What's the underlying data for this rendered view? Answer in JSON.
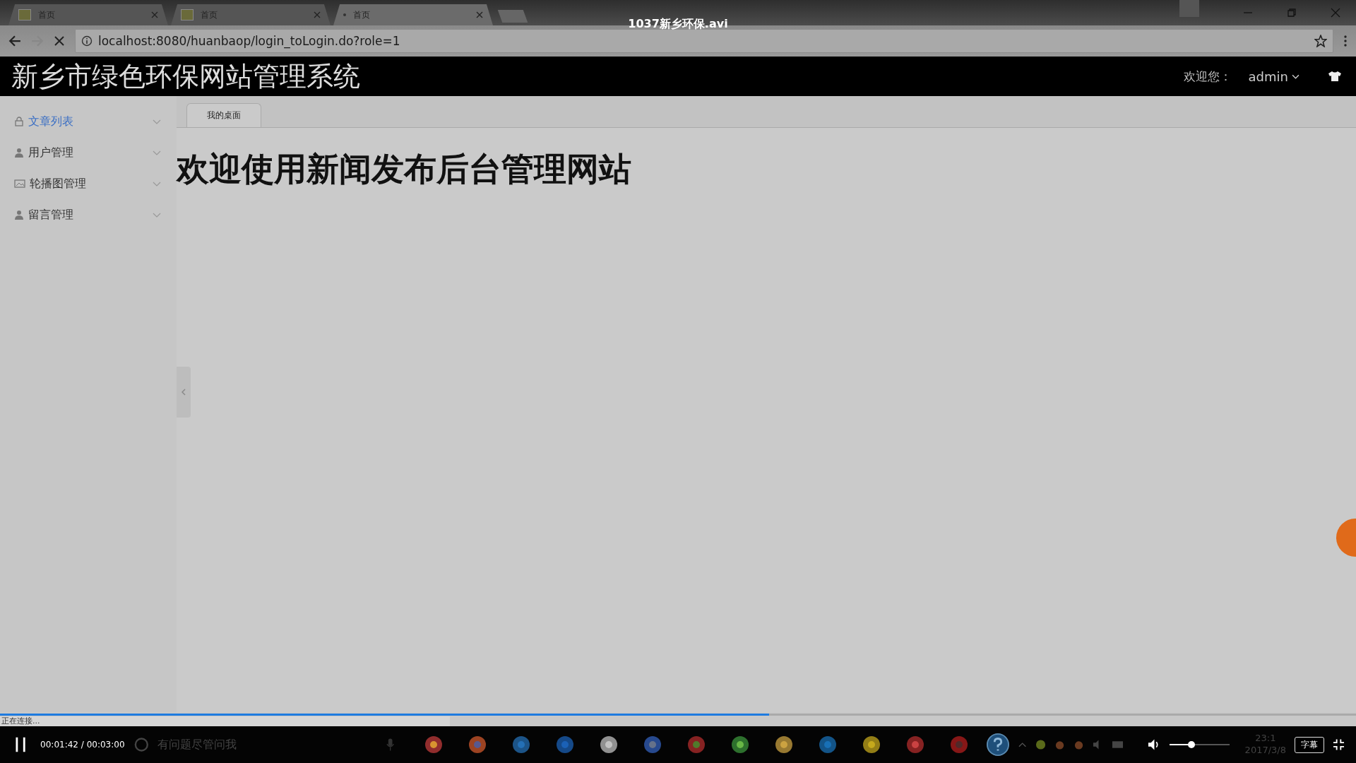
{
  "player": {
    "title": "1037新乡环保.avi",
    "playing": true,
    "time": "00:01:42 / 00:03:00",
    "progress": {
      "level": 0.567
    },
    "volume": {
      "level": 0.37
    },
    "subtitle_button": "字幕"
  },
  "browser": {
    "tabs": [
      {
        "label": "首页",
        "selected": false
      },
      {
        "label": "首页",
        "selected": false
      },
      {
        "label": "首页",
        "selected": true
      }
    ],
    "loading": true,
    "address": "localhost:8080/huanbaop/login_toLogin.do?role=1",
    "status": "正在连接..."
  },
  "app": {
    "title": "新乡市绿色环保网站管理系统",
    "welcome": "欢迎您：",
    "user": "admin",
    "sidebar": {
      "items": [
        {
          "label": "文章列表",
          "kind": "lock",
          "hovered": true
        },
        {
          "label": "用户管理",
          "kind": "user",
          "hovered": false
        },
        {
          "label": "轮播图管理",
          "kind": "image",
          "hovered": false
        },
        {
          "label": "留言管理",
          "kind": "user",
          "hovered": false
        }
      ]
    },
    "tabs": [
      {
        "label": "我的桌面",
        "selected": true
      }
    ],
    "heading": "欢迎使用新闻发布后台管理网站"
  },
  "taskbar": {
    "search_placeholder": "有问题尽管问我",
    "clock_time": "23:1",
    "clock_date": "2017/3/8"
  }
}
